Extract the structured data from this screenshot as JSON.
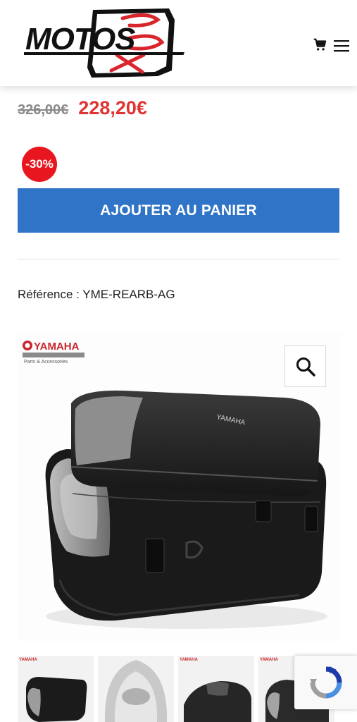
{
  "header": {
    "logo_text": "MOTOS BOX",
    "cart_icon": "cart-icon",
    "menu_icon": "hamburger-menu-icon"
  },
  "product": {
    "old_price": "326,00€",
    "new_price": "228,20€",
    "discount_badge": "-30%",
    "add_to_cart_label": "AJOUTER AU PANIER",
    "reference": "Référence : YME-REARB-AG"
  },
  "gallery": {
    "brand_logo_text": "YAMAHA",
    "brand_tagline": "Parts & Accessories",
    "bag_brand": "YAMAHA",
    "zoom_icon": "magnifier-icon",
    "thumbnail_brand": "YAMAHA"
  },
  "colors": {
    "accent_blue": "#2f74c7",
    "sale_red": "#e03434",
    "badge_red": "#e8171f"
  }
}
